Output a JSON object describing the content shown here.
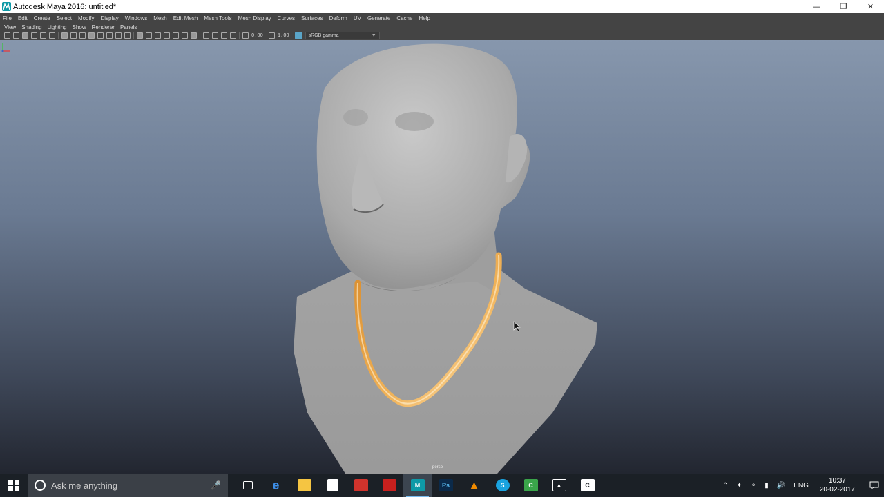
{
  "window": {
    "title": "Autodesk Maya 2016: untitled*",
    "minimize_icon": "minimize-icon",
    "restore_icon": "restore-icon",
    "close_icon": "close-icon"
  },
  "menubar": {
    "items": [
      "File",
      "Edit",
      "Create",
      "Select",
      "Modify",
      "Display",
      "Windows",
      "Mesh",
      "Edit Mesh",
      "Mesh Tools",
      "Mesh Display",
      "Curves",
      "Surfaces",
      "Deform",
      "UV",
      "Generate",
      "Cache",
      "Help"
    ]
  },
  "panel_menu": {
    "items": [
      "View",
      "Shading",
      "Lighting",
      "Show",
      "Renderer",
      "Panels"
    ]
  },
  "toolbar": {
    "exposure_value": "0.00",
    "gamma_value": "1.00",
    "color_space": "sRGB gamma"
  },
  "viewport": {
    "camera_label": "persp",
    "background_top": "#8797ad",
    "background_bottom": "#222630",
    "necklace_color": "#e8a24a"
  },
  "taskbar": {
    "search_placeholder": "Ask me anything",
    "apps": [
      "task-view",
      "edge",
      "file-explorer",
      "store",
      "app-red",
      "acrobat",
      "maya",
      "photoshop",
      "vlc",
      "skype",
      "camtasia",
      "photos",
      "camtasia-editor"
    ],
    "language": "ENG",
    "time": "10:37",
    "date": "20-02-2017"
  }
}
